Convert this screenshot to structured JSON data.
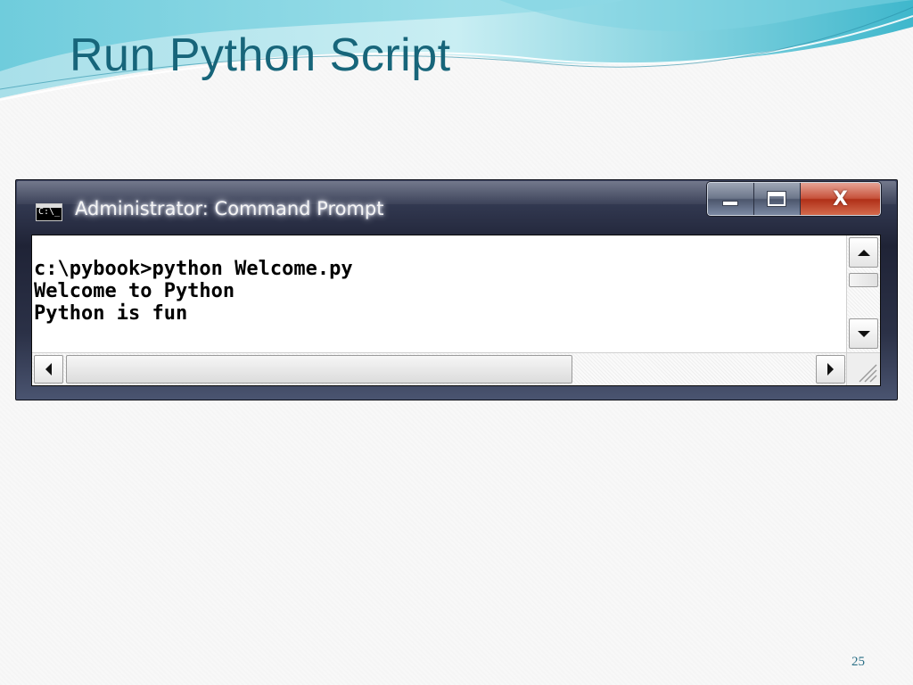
{
  "slide": {
    "title": "Run Python Script",
    "page_number": "25"
  },
  "window": {
    "icon_label": "C:\\_",
    "title": "Administrator: Command Prompt",
    "controls": {
      "minimize_icon": "minimize-icon",
      "maximize_icon": "maximize-icon",
      "close_icon": "close-icon",
      "close_glyph": "X"
    }
  },
  "console": {
    "lines": [
      "c:\\pybook>python Welcome.py",
      "Welcome to Python",
      "Python is fun"
    ]
  },
  "colors": {
    "title": "#17657a",
    "console_bg": "#ffffff",
    "console_text": "#000000",
    "close_button": "#c7533c"
  }
}
